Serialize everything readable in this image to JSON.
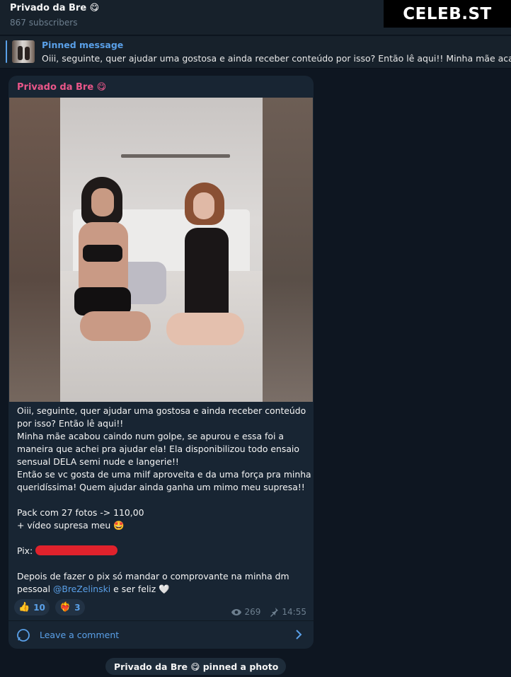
{
  "header": {
    "title": "Privado da Bre 😋",
    "subscribers": "867 subscribers"
  },
  "watermark": "CELEB.ST",
  "pinned": {
    "label": "Pinned message",
    "text": "Oiii, seguinte, quer ajudar uma gostosa e ainda receber conteúdo por isso? Então lê aqui!! Minha mãe acabou cai"
  },
  "post": {
    "author": "Privado da Bre 😋",
    "caption_lines": [
      "Oiii, seguinte, quer ajudar uma gostosa e ainda receber conteúdo",
      "por isso? Então lê aqui!!",
      "Minha mãe acabou caindo num golpe, se apurou e essa foi a",
      "maneira que achei pra ajudar ela! Ela disponibilizou todo ensaio",
      "sensual DELA semi nude e langerie!!",
      "Então se vc gosta de uma milf aproveita e da uma força pra minha",
      "queridíssima! Quem ajudar ainda ganha um mimo meu supresa!!",
      "",
      "Pack com 27 fotos -> 110,00",
      "+ vídeo supresa meu 🤩",
      ""
    ],
    "pix_label": "Pix:",
    "closing_line1": "Depois de fazer o pix só mandar o comprovante na minha dm",
    "closing_prefix": "pessoal ",
    "mention": "@BreZelinski",
    "closing_suffix": " e ser feliz 🤍",
    "reactions": [
      {
        "emoji": "👍",
        "count": "10"
      },
      {
        "emoji": "❤️‍🔥",
        "count": "3"
      }
    ],
    "views": "269",
    "time": "14:55",
    "comment_label": "Leave a comment"
  },
  "service_message": "Privado da Bre 😋 pinned a photo",
  "colors": {
    "background": "#0e1621",
    "panel": "#17212b",
    "bubble": "#182533",
    "accent": "#5aa0e8",
    "author": "#e95689",
    "muted": "#6d7f8f"
  },
  "icons": [
    "eye-icon",
    "pin-icon",
    "comment-icon",
    "chevron-right-icon"
  ]
}
